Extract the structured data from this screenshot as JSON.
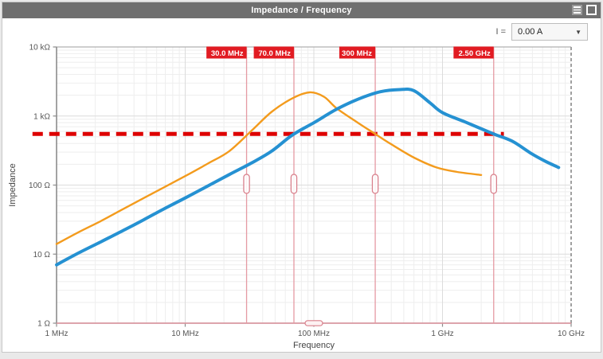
{
  "window": {
    "title": "Impedance / Frequency"
  },
  "controls": {
    "current_label": "I =",
    "current_value": "0.00 A",
    "dropdown_arrow": "▼"
  },
  "chart_data": {
    "type": "line",
    "title": "Impedance / Frequency",
    "x_axis": {
      "label": "Frequency",
      "scale": "log",
      "range_mhz": [
        1,
        10000
      ],
      "ticks": [
        {
          "mhz": 1,
          "label": "1 MHz"
        },
        {
          "mhz": 10,
          "label": "10 MHz"
        },
        {
          "mhz": 100,
          "label": "100 MHz"
        },
        {
          "mhz": 1000,
          "label": "1 GHz"
        },
        {
          "mhz": 10000,
          "label": "10 GHz"
        }
      ]
    },
    "y_axis": {
      "label": "Impedance",
      "scale": "log",
      "range_ohm": [
        1,
        10000
      ],
      "ticks": [
        {
          "ohm": 10000,
          "label": "10 kΩ"
        },
        {
          "ohm": 1000,
          "label": "1 kΩ"
        },
        {
          "ohm": 100,
          "label": "100 Ω"
        },
        {
          "ohm": 10,
          "label": "10 Ω"
        },
        {
          "ohm": 1,
          "label": "1 Ω"
        }
      ]
    },
    "grid": {
      "minor_color": "#eeeeee",
      "major_color": "#dcdcdc",
      "border_color": "#b0b0b0",
      "axis_color": "#8c8c8c",
      "tick_text_color": "#555555",
      "axis_title_color": "#444444"
    },
    "series": [
      {
        "name": "impedance-curve-orange",
        "color": "#f39b1d",
        "stroke_width": 2.4,
        "points_mhz_ohm": [
          [
            1,
            14
          ],
          [
            1.5,
            21
          ],
          [
            2.2,
            30
          ],
          [
            3.3,
            45
          ],
          [
            4.7,
            64
          ],
          [
            6.8,
            92
          ],
          [
            10,
            135
          ],
          [
            15,
            205
          ],
          [
            22,
            310
          ],
          [
            33,
            620
          ],
          [
            47,
            1150
          ],
          [
            68,
            1800
          ],
          [
            93,
            2200
          ],
          [
            120,
            1900
          ],
          [
            150,
            1300
          ],
          [
            220,
            800
          ],
          [
            300,
            550
          ],
          [
            400,
            390
          ],
          [
            600,
            250
          ],
          [
            900,
            180
          ],
          [
            1300,
            155
          ],
          [
            2000,
            140
          ]
        ]
      },
      {
        "name": "impedance-curve-blue",
        "color": "#2591d2",
        "stroke_width": 4,
        "points_mhz_ohm": [
          [
            1,
            7
          ],
          [
            1.5,
            10.5
          ],
          [
            2.2,
            15
          ],
          [
            3.3,
            22
          ],
          [
            4.7,
            31
          ],
          [
            6.8,
            45
          ],
          [
            10,
            65
          ],
          [
            15,
            97
          ],
          [
            22,
            142
          ],
          [
            33,
            210
          ],
          [
            47,
            310
          ],
          [
            68,
            530
          ],
          [
            100,
            800
          ],
          [
            150,
            1250
          ],
          [
            220,
            1750
          ],
          [
            330,
            2250
          ],
          [
            470,
            2420
          ],
          [
            600,
            2330
          ],
          [
            800,
            1550
          ],
          [
            1000,
            1120
          ],
          [
            1500,
            820
          ],
          [
            2500,
            550
          ],
          [
            3500,
            430
          ],
          [
            5000,
            280
          ],
          [
            6500,
            215
          ],
          [
            8000,
            180
          ]
        ]
      }
    ],
    "threshold_line": {
      "value_ohm": 550,
      "from_mhz": 0.65,
      "to_mhz": 3000,
      "color": "#dd0000",
      "style": "dashed"
    },
    "frequency_markers": {
      "line_color": "#e59aa3",
      "label_bg": "#e11b22",
      "label_text_color": "#ffffff",
      "items": [
        {
          "label": "30.0 MHz",
          "mhz": 30
        },
        {
          "label": "70.0 MHz",
          "mhz": 70
        },
        {
          "label": "300 MHz",
          "mhz": 300
        },
        {
          "label": "2.50 GHz",
          "mhz": 2500
        }
      ]
    },
    "baseline_marker": {
      "value_ohm": 1,
      "handle_mhz": 100,
      "line_color": "#e59aa3"
    }
  }
}
